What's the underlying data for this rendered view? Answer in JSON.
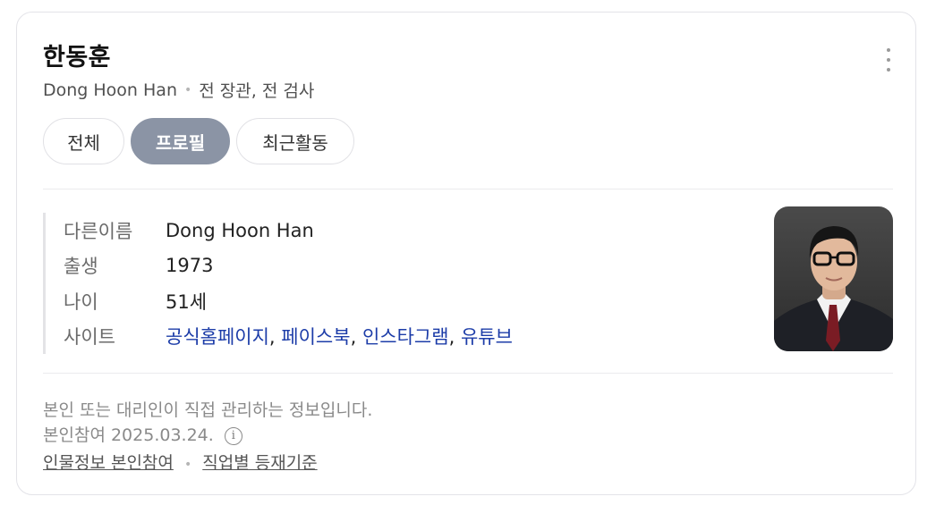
{
  "profile": {
    "name": "한동훈",
    "english_name": "Dong Hoon Han",
    "description": "전 장관, 전 검사"
  },
  "tabs": [
    "전체",
    "프로필",
    "최근활동"
  ],
  "active_tab": "프로필",
  "info": {
    "alias_label": "다른이름",
    "alias_value": "Dong Hoon Han",
    "birth_label": "출생",
    "birth_value": "1973",
    "age_label": "나이",
    "age_value": "51세",
    "site_label": "사이트",
    "sites": [
      "공식홈페이지",
      "페이스북",
      "인스타그램",
      "유튜브"
    ],
    "site_separator": ","
  },
  "footer": {
    "notice": "본인 또는 대리인이 직접 관리하는 정보입니다.",
    "participation": "본인참여 2025.03.24.",
    "info_icon_glyph": "i",
    "link_participate": "인물정보 본인참여",
    "link_criteria": "직업별 등재기준"
  },
  "icons": {
    "more": "more-vertical-icon",
    "info": "info-circle-icon"
  },
  "colors": {
    "active_tab_bg": "#8b94a5",
    "link_blue": "#1c3ca8"
  }
}
